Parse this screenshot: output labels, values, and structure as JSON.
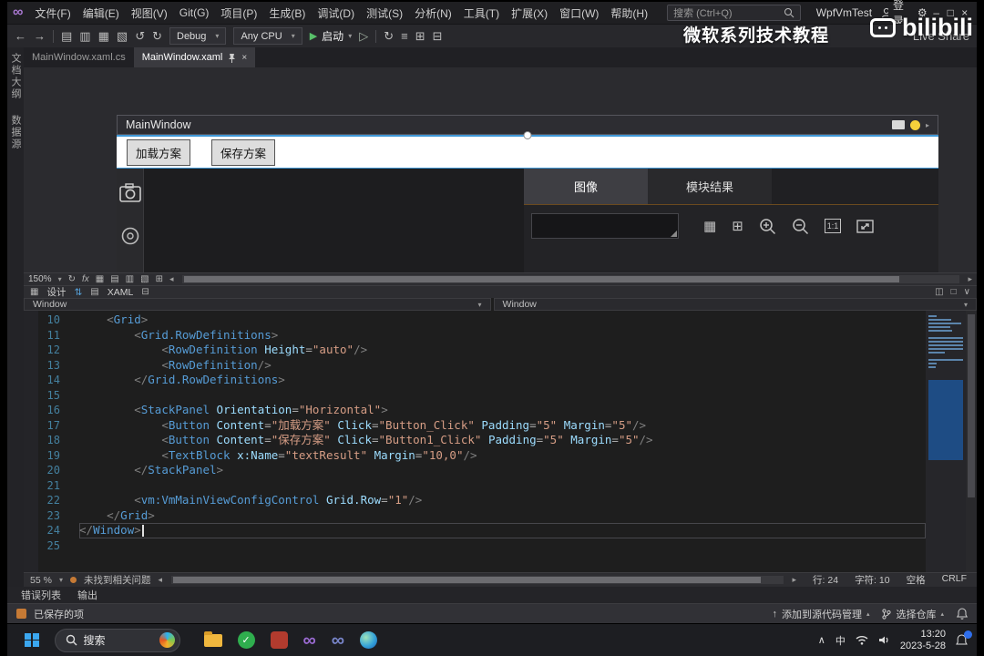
{
  "titlebar": {
    "menus": [
      "文件(F)",
      "编辑(E)",
      "视图(V)",
      "Git(G)",
      "项目(P)",
      "生成(B)",
      "调试(D)",
      "测试(S)",
      "分析(N)",
      "工具(T)",
      "扩展(X)",
      "窗口(W)",
      "帮助(H)"
    ],
    "search": "搜索 (Ctrl+Q)",
    "solution": "WpfVmTest",
    "sign_in": "登录",
    "minimize": "–",
    "maximize": "□",
    "close": "×"
  },
  "toolbar": {
    "config": "Debug",
    "platform": "Any CPU",
    "start": "启动",
    "live_share": "Live Share"
  },
  "watermark": {
    "title": "微软系列技术教程",
    "logo": "bilibili"
  },
  "rail": {
    "tab1": "文档大纲",
    "tab2": "数据源"
  },
  "doc_tabs": {
    "inactive": "MainWindow.xaml.cs",
    "active": "MainWindow.xaml"
  },
  "designer": {
    "zoom": "150%",
    "window_title": "MainWindow",
    "button1": "加载方案",
    "button2": "保存方案",
    "tab_image": "图像",
    "tab_result": "模块结果",
    "one_to_one": "1:1"
  },
  "split": {
    "design": "设计",
    "xaml": "XAML"
  },
  "crumbs": {
    "left": "Window",
    "right": "Window"
  },
  "editor": {
    "zoom": "55 %",
    "message": "未找到相关问题",
    "line": "行: 24",
    "char": "字符: 10",
    "spaces": "空格",
    "eol": "CRLF",
    "code": {
      "current_line": 24,
      "cursor_col": 10,
      "lines": [
        {
          "n": 10,
          "t": [
            [
              "w",
              "    "
            ],
            [
              "p",
              "<"
            ],
            [
              "t",
              "Grid"
            ],
            [
              "p",
              ">"
            ]
          ]
        },
        {
          "n": 11,
          "t": [
            [
              "w",
              "        "
            ],
            [
              "p",
              "<"
            ],
            [
              "t",
              "Grid.RowDefinitions"
            ],
            [
              "p",
              ">"
            ]
          ]
        },
        {
          "n": 12,
          "t": [
            [
              "w",
              "            "
            ],
            [
              "p",
              "<"
            ],
            [
              "t",
              "RowDefinition"
            ],
            [
              "w",
              " "
            ],
            [
              "a",
              "Height"
            ],
            [
              "o",
              "="
            ],
            [
              "s",
              "\"auto\""
            ],
            [
              "p",
              "/>"
            ]
          ]
        },
        {
          "n": 13,
          "t": [
            [
              "w",
              "            "
            ],
            [
              "p",
              "<"
            ],
            [
              "t",
              "RowDefinition"
            ],
            [
              "p",
              "/>"
            ]
          ]
        },
        {
          "n": 14,
          "t": [
            [
              "w",
              "        "
            ],
            [
              "p",
              "</"
            ],
            [
              "t",
              "Grid.RowDefinitions"
            ],
            [
              "p",
              ">"
            ]
          ]
        },
        {
          "n": 15,
          "t": []
        },
        {
          "n": 16,
          "t": [
            [
              "w",
              "        "
            ],
            [
              "p",
              "<"
            ],
            [
              "t",
              "StackPanel"
            ],
            [
              "w",
              " "
            ],
            [
              "a",
              "Orientation"
            ],
            [
              "o",
              "="
            ],
            [
              "s",
              "\"Horizontal\""
            ],
            [
              "p",
              ">"
            ]
          ]
        },
        {
          "n": 17,
          "t": [
            [
              "w",
              "            "
            ],
            [
              "p",
              "<"
            ],
            [
              "t",
              "Button"
            ],
            [
              "w",
              " "
            ],
            [
              "a",
              "Content"
            ],
            [
              "o",
              "="
            ],
            [
              "s",
              "\"加载方案\""
            ],
            [
              "w",
              " "
            ],
            [
              "a",
              "Click"
            ],
            [
              "o",
              "="
            ],
            [
              "s",
              "\"Button_Click\""
            ],
            [
              "w",
              " "
            ],
            [
              "a",
              "Padding"
            ],
            [
              "o",
              "="
            ],
            [
              "s",
              "\"5\""
            ],
            [
              "w",
              " "
            ],
            [
              "a",
              "Margin"
            ],
            [
              "o",
              "="
            ],
            [
              "s",
              "\"5\""
            ],
            [
              "p",
              "/>"
            ]
          ]
        },
        {
          "n": 18,
          "t": [
            [
              "w",
              "            "
            ],
            [
              "p",
              "<"
            ],
            [
              "t",
              "Button"
            ],
            [
              "w",
              " "
            ],
            [
              "a",
              "Content"
            ],
            [
              "o",
              "="
            ],
            [
              "s",
              "\"保存方案\""
            ],
            [
              "w",
              " "
            ],
            [
              "a",
              "Click"
            ],
            [
              "o",
              "="
            ],
            [
              "s",
              "\"Button1_Click\""
            ],
            [
              "w",
              " "
            ],
            [
              "a",
              "Padding"
            ],
            [
              "o",
              "="
            ],
            [
              "s",
              "\"5\""
            ],
            [
              "w",
              " "
            ],
            [
              "a",
              "Margin"
            ],
            [
              "o",
              "="
            ],
            [
              "s",
              "\"5\""
            ],
            [
              "p",
              "/>"
            ]
          ]
        },
        {
          "n": 19,
          "t": [
            [
              "w",
              "            "
            ],
            [
              "p",
              "<"
            ],
            [
              "t",
              "TextBlock"
            ],
            [
              "w",
              " "
            ],
            [
              "a",
              "x:Name"
            ],
            [
              "o",
              "="
            ],
            [
              "s",
              "\"textResult\""
            ],
            [
              "w",
              " "
            ],
            [
              "a",
              "Margin"
            ],
            [
              "o",
              "="
            ],
            [
              "s",
              "\"10,0\""
            ],
            [
              "p",
              "/>"
            ]
          ]
        },
        {
          "n": 20,
          "t": [
            [
              "w",
              "        "
            ],
            [
              "p",
              "</"
            ],
            [
              "t",
              "StackPanel"
            ],
            [
              "p",
              ">"
            ]
          ]
        },
        {
          "n": 21,
          "t": []
        },
        {
          "n": 22,
          "t": [
            [
              "w",
              "        "
            ],
            [
              "p",
              "<"
            ],
            [
              "t",
              "vm:VmMainViewConfigControl"
            ],
            [
              "w",
              " "
            ],
            [
              "a",
              "Grid.Row"
            ],
            [
              "o",
              "="
            ],
            [
              "s",
              "\"1\""
            ],
            [
              "p",
              "/>"
            ]
          ]
        },
        {
          "n": 23,
          "t": [
            [
              "w",
              "    "
            ],
            [
              "p",
              "</"
            ],
            [
              "t",
              "Grid"
            ],
            [
              "p",
              ">"
            ]
          ]
        },
        {
          "n": 24,
          "t": [
            [
              "p",
              "</"
            ],
            [
              "t",
              "Window"
            ],
            [
              "p",
              ">"
            ]
          ]
        },
        {
          "n": 25,
          "t": []
        }
      ]
    }
  },
  "panel_tabs": {
    "error_list": "错误列表",
    "output": "输出"
  },
  "statusbar": {
    "saved": "已保存的项",
    "add_scc": "添加到源代码管理",
    "repo": "选择仓库"
  },
  "taskbar": {
    "search": "搜索",
    "ime": "中",
    "time": "13:20",
    "date": "2023-5-28"
  }
}
